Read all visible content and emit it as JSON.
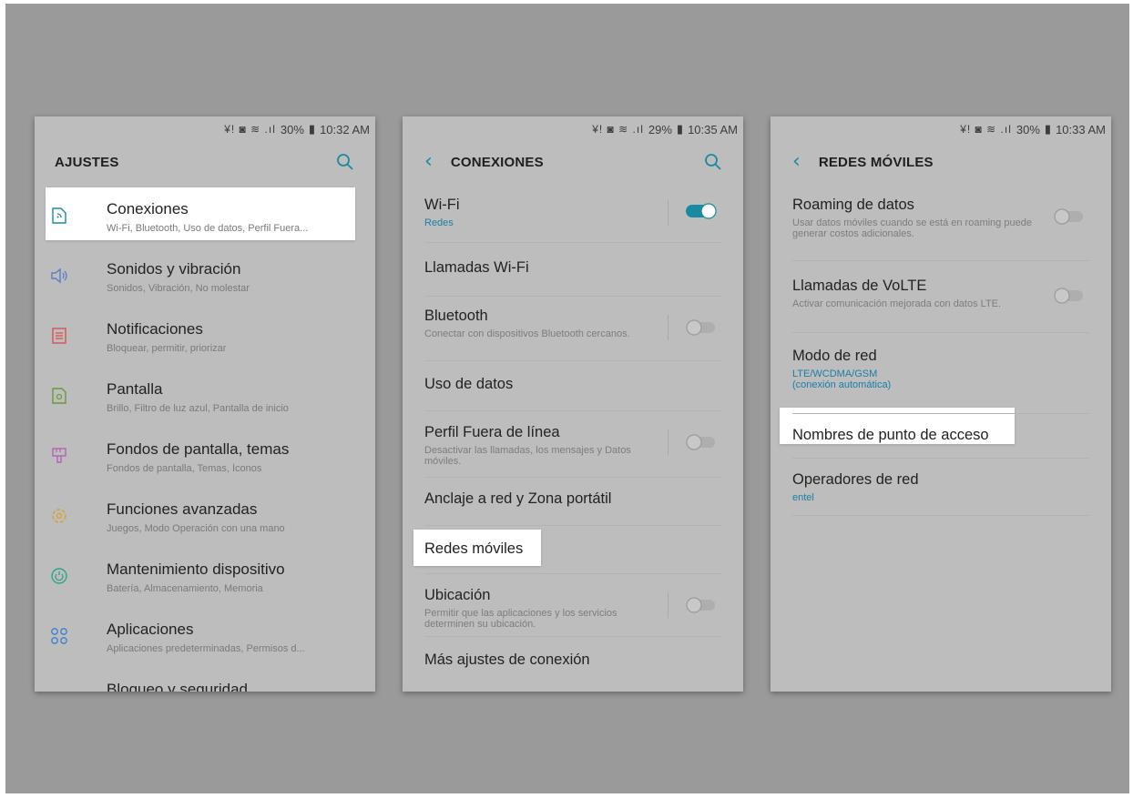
{
  "phones": [
    {
      "status": {
        "icons": "¥! ◙ ≋ .ıl",
        "battery": "30%",
        "time": "10:32 AM"
      },
      "title": "AJUSTES",
      "items": [
        {
          "title": "Conexiones",
          "sub": "Wi-Fi, Bluetooth, Uso de datos, Perfil Fuera..."
        },
        {
          "title": "Sonidos y vibración",
          "sub": "Sonidos, Vibración, No molestar"
        },
        {
          "title": "Notificaciones",
          "sub": "Bloquear, permitir, priorizar"
        },
        {
          "title": "Pantalla",
          "sub": "Brillo, Filtro de luz azul, Pantalla de inicio"
        },
        {
          "title": "Fondos de pantalla, temas",
          "sub": "Fondos de pantalla, Temas, Íconos"
        },
        {
          "title": "Funciones avanzadas",
          "sub": "Juegos, Modo Operación con una mano"
        },
        {
          "title": "Mantenimiento dispositivo",
          "sub": "Batería, Almacenamiento, Memoria"
        },
        {
          "title": "Aplicaciones",
          "sub": "Aplicaciones predeterminadas, Permisos d..."
        },
        {
          "title": "Bloqueo y seguridad",
          "sub": ""
        }
      ]
    },
    {
      "status": {
        "icons": "¥! ◙ ≋ .ıl",
        "battery": "29%",
        "time": "10:35 AM"
      },
      "title": "CONEXIONES",
      "items": [
        {
          "title": "Wi-Fi",
          "accent": "Redes",
          "toggle": "on"
        },
        {
          "title": "Llamadas Wi-Fi"
        },
        {
          "title": "Bluetooth",
          "desc": "Conectar con dispositivos Bluetooth cercanos.",
          "toggle": "off"
        },
        {
          "title": "Uso de datos"
        },
        {
          "title": "Perfil Fuera de línea",
          "desc": "Desactivar las llamadas, los mensajes y Datos móviles.",
          "toggle": "off"
        },
        {
          "title": "Anclaje a red y Zona portátil"
        },
        {
          "title": "Redes móviles"
        },
        {
          "title": "Ubicación",
          "desc": "Permitir que las aplicaciones y los servicios determinen su ubicación.",
          "toggle": "off"
        },
        {
          "title": "Más ajustes de conexión"
        }
      ]
    },
    {
      "status": {
        "icons": "¥! ◙ ≋ .ıl",
        "battery": "30%",
        "time": "10:33 AM"
      },
      "title": "REDES MÓVILES",
      "items": [
        {
          "title": "Roaming de datos",
          "desc": "Usar datos móviles cuando se está en roaming puede generar costos adicionales.",
          "toggle": "off"
        },
        {
          "title": "Llamadas de VoLTE",
          "desc": "Activar comunicación mejorada con datos LTE.",
          "toggle": "off"
        },
        {
          "title": "Modo de red",
          "accent": "LTE/WCDMA/GSM",
          "accent2": "(conexión automática)"
        },
        {
          "title": "Nombres de punto de acceso"
        },
        {
          "title": "Operadores de red",
          "accent": "entel"
        }
      ]
    }
  ],
  "colors": {
    "accent": "#1a8aa0",
    "backdrop": "#9a9a9a",
    "screen": "#bdbdbd"
  }
}
